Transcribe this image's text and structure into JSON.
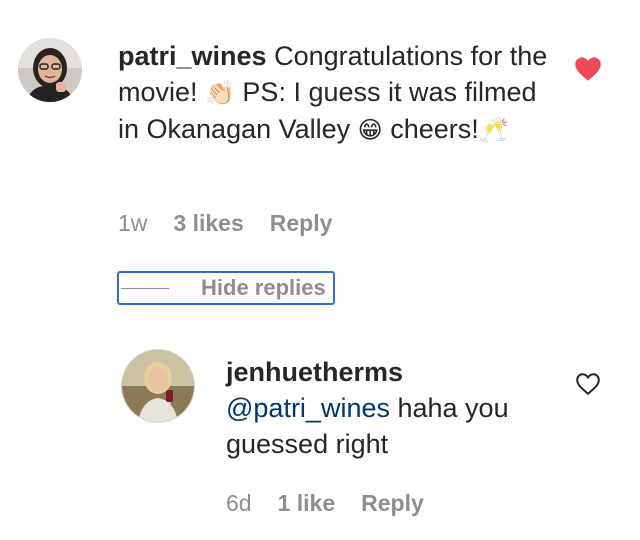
{
  "comment": {
    "username": "patri_wines",
    "text_part1": " Congratulations for the movie! ",
    "emoji_clap": "👏🏻",
    "text_part2": " PS: I guess it was filmed in Okanagan Valley ",
    "emoji_grin": "😁",
    "text_part3": " cheers!",
    "emoji_cheers": "🥂",
    "time": "1w",
    "likes": "3 likes",
    "reply": "Reply",
    "liked": true,
    "heart_color": "#ed4956"
  },
  "hide_replies": {
    "label": "Hide replies"
  },
  "reply": {
    "username": "jenhuetherms",
    "mention": "@patri_wines",
    "text": " haha you guessed right",
    "time": "6d",
    "likes": "1 like",
    "reply": "Reply",
    "liked": false
  },
  "colors": {
    "text": "#262626",
    "secondary": "#8e8e8e",
    "mention": "#00376b",
    "focus_outline": "#2f6fd6"
  }
}
